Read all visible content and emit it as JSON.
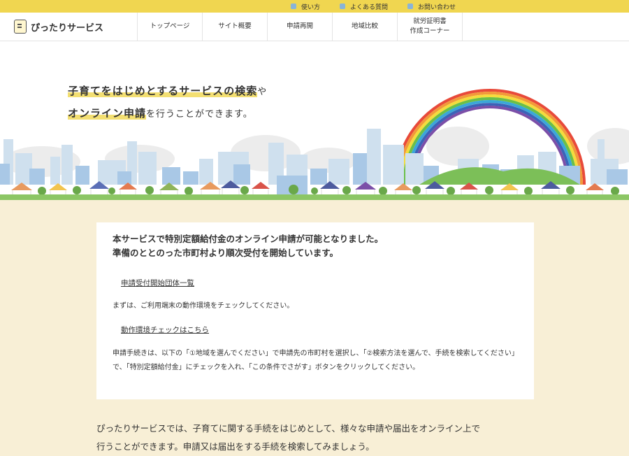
{
  "topbar": {
    "links": [
      {
        "label": "使い方",
        "icon": "square-icon"
      },
      {
        "label": "よくある質問",
        "icon": "square-icon"
      },
      {
        "label": "お問い合わせ",
        "icon": "square-icon"
      }
    ]
  },
  "header": {
    "logo_text": "ぴったりサービス",
    "nav": [
      {
        "label": "トップページ"
      },
      {
        "label": "サイト概要"
      },
      {
        "label": "申請再開"
      },
      {
        "label": "地域比較"
      },
      {
        "label_line1": "就労証明書",
        "label_line2": "作成コーナー"
      }
    ]
  },
  "hero": {
    "line1_highlight": "子育てをはじめとするサービスの検索",
    "line1_suffix": "や",
    "line2_highlight": "オンライン申請",
    "line2_suffix": "を行うことができます。"
  },
  "notice": {
    "headline_line1": "本サービスで特別定額給付金のオンライン申請が可能となりました。",
    "headline_line2": "準備のととのった市町村より順次受付を開始しています。",
    "link1": "申請受付開始団体一覧",
    "text1": "まずは、ご利用端末の動作環境をチェックしてください。",
    "link2": "動作環境チェックはこちら",
    "text2": "申請手続きは、以下の「①地域を選んでください」で申請先の市町村を選択し、「②検索方法を選んで、手続を検索してください」で、「特別定額給付金」にチェックを入れ、「この条件でさがす」ボタンをクリックしてください。"
  },
  "main": {
    "intro_line1": "ぴったりサービスでは、子育てに関する手続をはじめとして、様々な申請や届出をオンライン上で",
    "intro_line2": "行うことができます。申請又は届出をする手続を検索してみましょう。"
  }
}
